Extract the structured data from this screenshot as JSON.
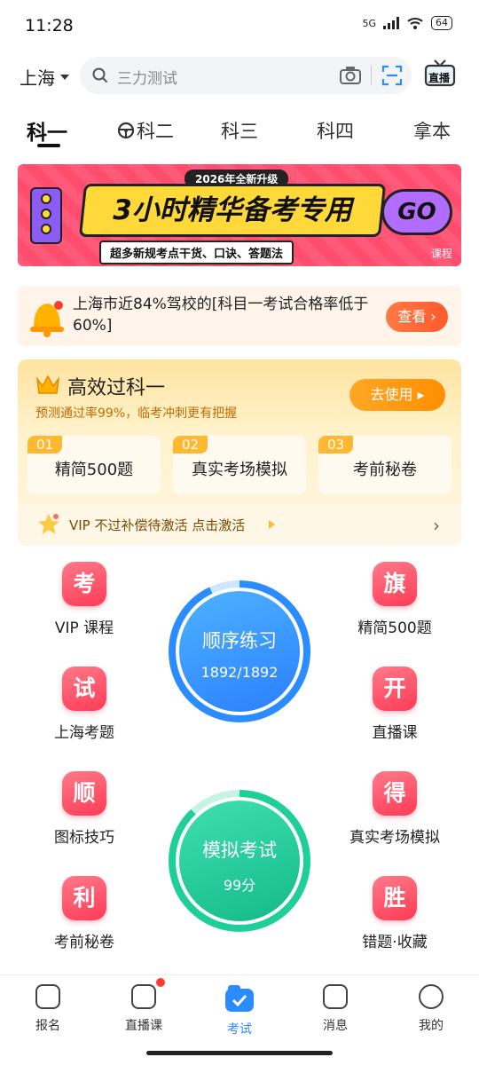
{
  "status": {
    "time": "11:28",
    "network": "5G",
    "battery": "64"
  },
  "header": {
    "city": "上海",
    "search_placeholder": "三力测试",
    "live_label": "直播"
  },
  "tabs": [
    "科一",
    "科二",
    "科三",
    "科四",
    "拿本"
  ],
  "banner": {
    "top_label": "2026年全新升级",
    "title": "3小时精华备考专用",
    "subtitle": "超多新规考点干货、口诀、答题法",
    "go": "GO",
    "course": "课程"
  },
  "notice": {
    "text": "上海市近84%驾校的[科目一考试合格率低于60%]",
    "button": "查看 ›"
  },
  "promo": {
    "title": "高效过科一",
    "subtitle": "预测通过率99%，临考冲刺更有把握",
    "button": "去使用 ▸",
    "chips": [
      {
        "num": "01",
        "label": "精简500题"
      },
      {
        "num": "02",
        "label": "真实考场模拟"
      },
      {
        "num": "03",
        "label": "考前秘卷"
      }
    ],
    "vip_text": "VIP 不过补偿待激活 点击激活"
  },
  "grid": [
    {
      "icon": "考",
      "label": "VIP 课程"
    },
    {
      "icon": "旗",
      "label": "精简500题"
    },
    {
      "icon": "试",
      "label": "上海考题"
    },
    {
      "icon": "开",
      "label": "直播课"
    },
    {
      "icon": "顺",
      "label": "图标技巧"
    },
    {
      "icon": "得",
      "label": "真实考场模拟"
    },
    {
      "icon": "利",
      "label": "考前秘卷"
    },
    {
      "icon": "胜",
      "label": "错题·收藏"
    }
  ],
  "order_practice": {
    "title": "顺序练习",
    "progress": "1892/1892",
    "progress_fraction": 1.0
  },
  "mock_exam": {
    "title": "模拟考试",
    "score": "99分"
  },
  "bottom_nav": [
    "报名",
    "直播课",
    "考试",
    "消息",
    "我的"
  ],
  "colors": {
    "accent_blue": "#2b8cff",
    "accent_green": "#1fcf9a",
    "red_icon": "#ff3b55",
    "orange": "#ff8f00"
  }
}
